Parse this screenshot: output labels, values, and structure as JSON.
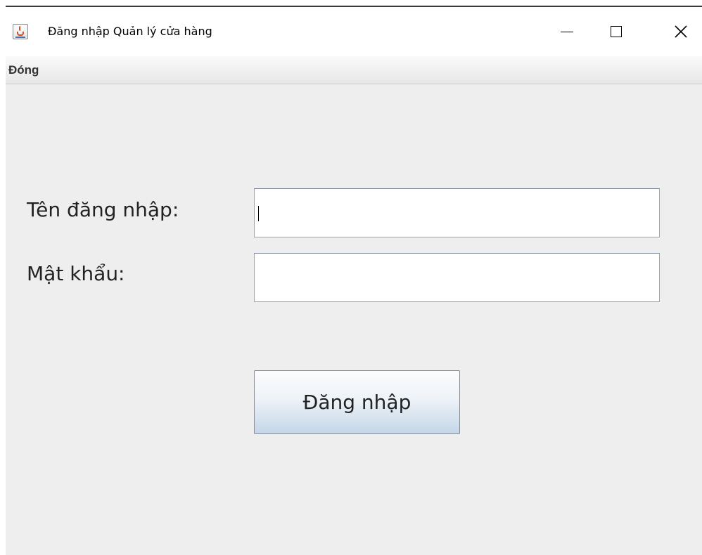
{
  "window": {
    "title": "Đăng nhập Quản lý cửa hàng",
    "app_icon": "java-cup-icon",
    "controls": {
      "minimize": "minimize-icon",
      "maximize": "maximize-icon",
      "close": "close-icon",
      "close_glyph": "✕"
    }
  },
  "menubar": {
    "items": [
      {
        "label": "Đóng"
      }
    ]
  },
  "form": {
    "username": {
      "label": "Tên đăng nhập:",
      "value": ""
    },
    "password": {
      "label": "Mật khẩu:",
      "value": ""
    },
    "submit_label": "Đăng nhập"
  },
  "colors": {
    "background": "#eeeeee",
    "button_gradient_bottom": "#c5d6e8",
    "field_border": "#9aa4b4"
  }
}
